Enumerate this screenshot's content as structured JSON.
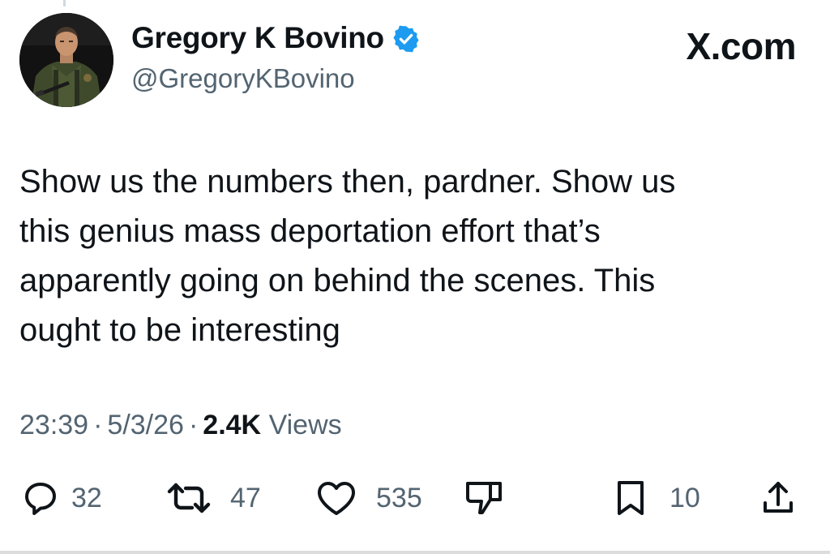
{
  "author": {
    "display_name": "Gregory K Bovino",
    "handle": "@GregoryKBovino",
    "verified": true,
    "avatar": "profile-photo"
  },
  "site_label": "X.com",
  "tweet": {
    "text": "Show us the numbers then, pardner.  Show us\nthis genius mass deportation effort that’s\napparently going on behind the scenes.  This\nought to be interesting"
  },
  "meta": {
    "time": "23:39",
    "date": "5/3/26",
    "views_count": "2.4K",
    "views_label": "Views",
    "separator": "·"
  },
  "actions": {
    "replies": "32",
    "reposts": "47",
    "likes": "535",
    "bookmarks": "10"
  },
  "colors": {
    "text": "#0f1419",
    "secondary": "#536471",
    "verified_badge": "#1d9bf0"
  }
}
